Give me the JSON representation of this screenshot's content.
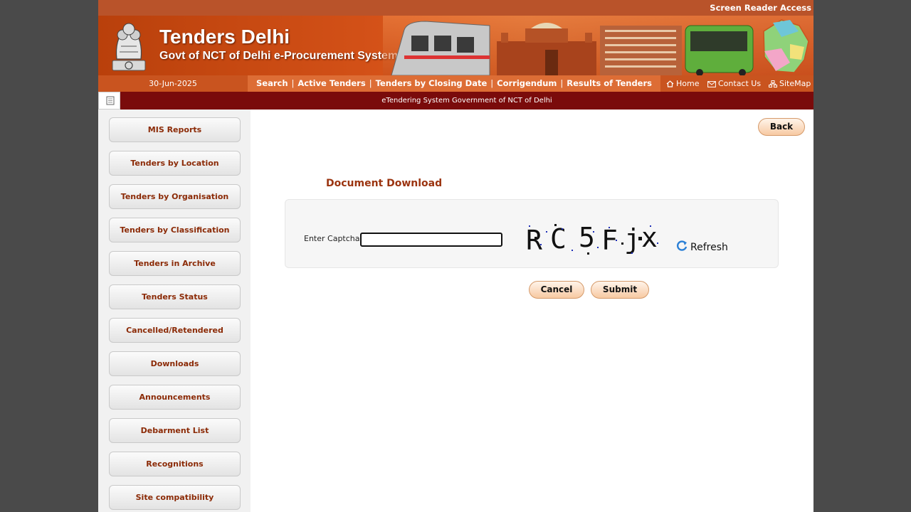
{
  "top": {
    "screen_reader": "Screen Reader Access"
  },
  "banner": {
    "title": "Tenders Delhi",
    "subtitle": "Govt of NCT of Delhi e-Procurement System"
  },
  "nav": {
    "date": "30-Jun-2025",
    "menu": [
      "Search",
      "Active Tenders",
      "Tenders by Closing Date",
      "Corrigendum",
      "Results of Tenders"
    ],
    "separator": "|",
    "home": "Home",
    "contact": "Contact Us",
    "sitemap": "SiteMap"
  },
  "marquee": {
    "text": "eTendering System Government of NCT of Delhi"
  },
  "sidebar": {
    "items": [
      "MIS Reports",
      "Tenders by Location",
      "Tenders by Organisation",
      "Tenders by Classification",
      "Tenders in Archive",
      "Tenders Status",
      "Cancelled/Retendered",
      "Downloads",
      "Announcements",
      "Debarment List",
      "Recognitions",
      "Site compatibility"
    ]
  },
  "main": {
    "back": "Back",
    "section_title": "Document Download",
    "captcha_label": "Enter Captcha",
    "captcha_value": "",
    "captcha_chars": [
      "R",
      "C",
      "5",
      "F",
      "j",
      "x"
    ],
    "refresh": "Refresh",
    "cancel": "Cancel",
    "submit": "Submit"
  },
  "colors": {
    "brand_orange": "#c9541f",
    "marquee_bg": "#7a0b0b",
    "link_brown": "#8b2a06"
  }
}
